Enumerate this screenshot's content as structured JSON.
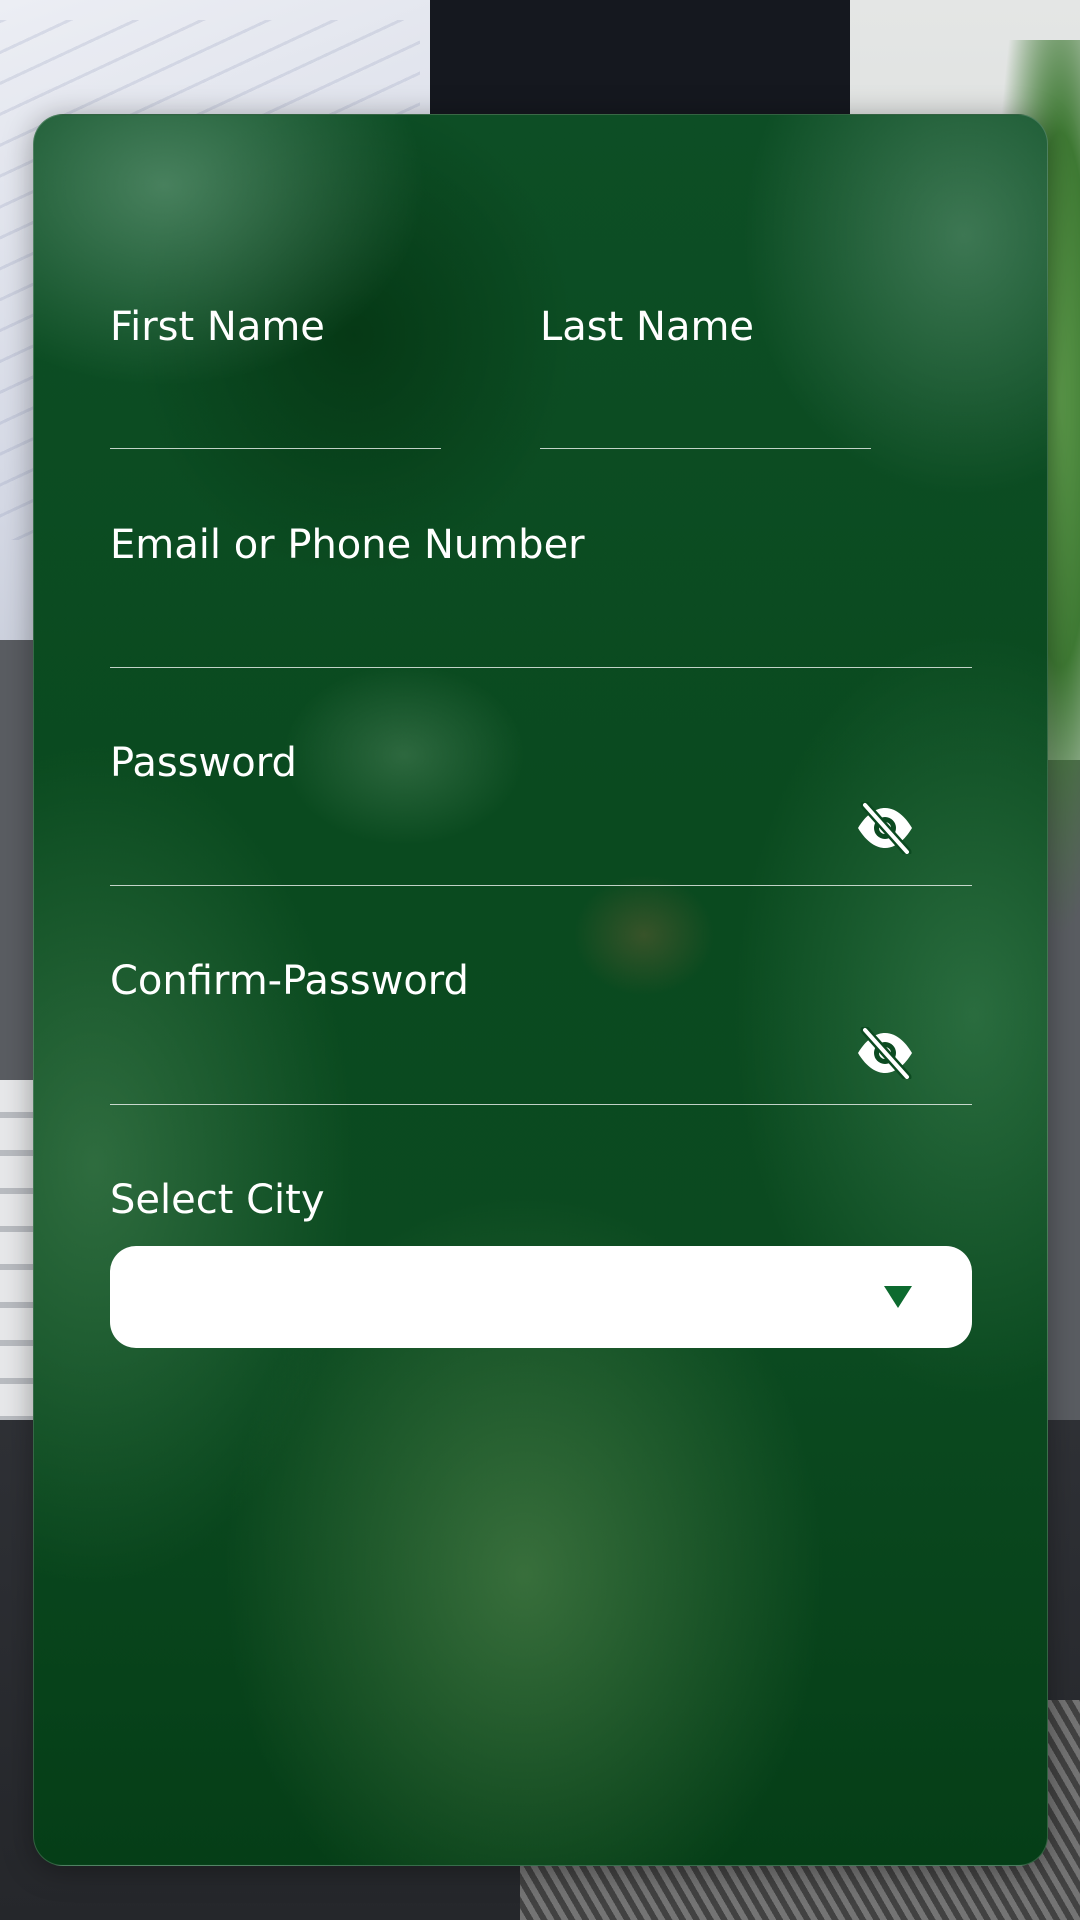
{
  "form": {
    "first_name": {
      "label": "First Name",
      "value": ""
    },
    "last_name": {
      "label": "Last Name",
      "value": ""
    },
    "contact": {
      "label": "Email or Phone Number",
      "value": ""
    },
    "password": {
      "label": "Password",
      "value": "",
      "toggle_icon": "eye-off-icon"
    },
    "confirm_password": {
      "label": "Confirm-Password",
      "value": "",
      "toggle_icon": "eye-off-icon"
    },
    "city": {
      "label": "Select City",
      "selected": "",
      "arrow_icon": "caret-down-icon"
    }
  },
  "colors": {
    "card_green": "#0b4a20",
    "text": "#ffffff",
    "dropdown_arrow": "#0d6a2f"
  }
}
